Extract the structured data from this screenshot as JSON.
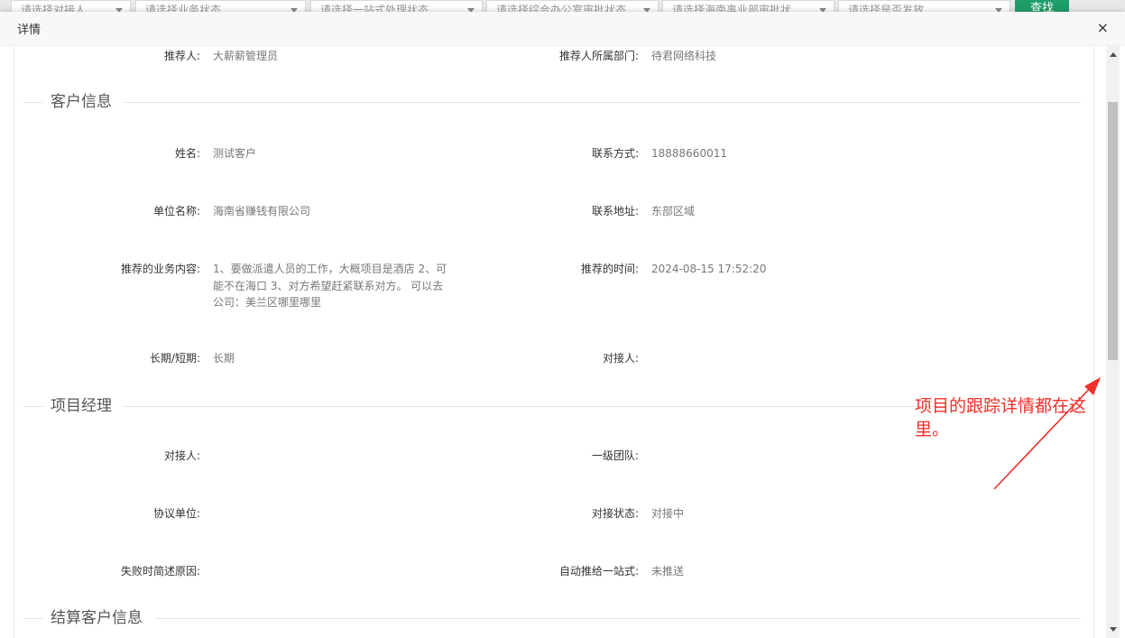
{
  "background_filters": {
    "selects": [
      "请选择对接人",
      "请选择业务状态",
      "请选择一站式处理状态",
      "请选择综合办公室审批状态",
      "请选择海南事业部审批状",
      "请选择是否发放"
    ],
    "search_button": "查找"
  },
  "modal": {
    "title": "详情",
    "close_glyph": "×"
  },
  "recommender": {
    "left_label": "推荐人:",
    "left_value": "大薪薪管理员",
    "right_label": "推荐人所属部门:",
    "right_value": "待君网络科技"
  },
  "customer_section": {
    "title": "客户信息",
    "rows": [
      {
        "left_label": "姓名:",
        "left_value": "测试客户",
        "right_label": "联系方式:",
        "right_value": "18888660011"
      },
      {
        "left_label": "单位名称:",
        "left_value": "海南省赚钱有限公司",
        "right_label": "联系地址:",
        "right_value": "东部区域"
      },
      {
        "left_label": "推荐的业务内容:",
        "left_value": "1、要做派遣人员的工作，大概项目是酒店 2、可能不在海口 3、对方希望赶紧联系对方。 可以去公司：美兰区哪里哪里",
        "right_label": "推荐的时间:",
        "right_value": "2024-08-15 17:52:20"
      },
      {
        "left_label": "长期/短期:",
        "left_value": "长期",
        "right_label": "对接人:",
        "right_value": ""
      }
    ]
  },
  "manager_section": {
    "title": "项目经理",
    "rows": [
      {
        "left_label": "对接人:",
        "left_value": "",
        "right_label": "一级团队:",
        "right_value": ""
      },
      {
        "left_label": "协议单位:",
        "left_value": "",
        "right_label": "对接状态:",
        "right_value": "对接中"
      },
      {
        "left_label": "失败时简述原因:",
        "left_value": "",
        "right_label": "自动推给一站式:",
        "right_value": "未推送"
      }
    ]
  },
  "settlement_section": {
    "title": "结算客户信息"
  },
  "annotation": {
    "text": "项目的跟踪详情都在这里。",
    "color": "#f0302a"
  },
  "colors": {
    "search_button": "#1e9e6a"
  }
}
